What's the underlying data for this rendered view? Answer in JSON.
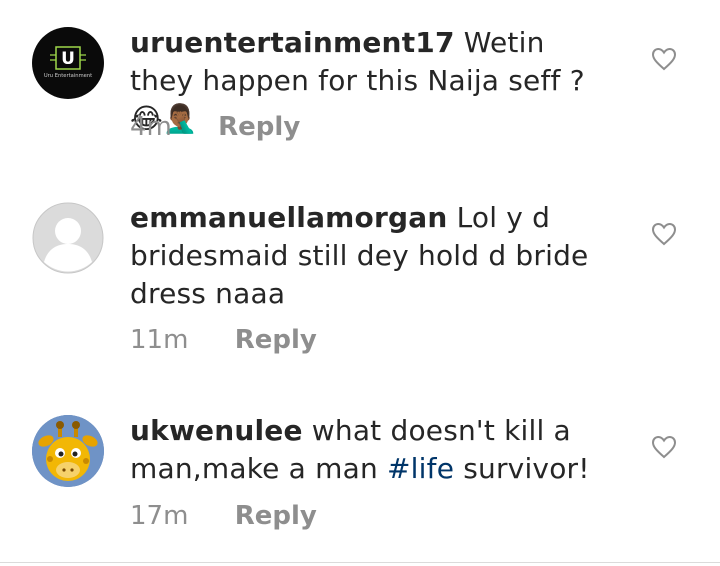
{
  "comments": [
    {
      "username": "uruentertainment17",
      "text": "Wetin they happen for this Naija seff ?",
      "emojis": "😂🤦🏾‍♂️",
      "time": "4m",
      "reply_label": "Reply",
      "avatar": {
        "letter": "U",
        "caption": "Uru Entertainment",
        "bg": "#0a0a0a",
        "accent": "#9ed84a"
      }
    },
    {
      "username": "emmanuellamorgan",
      "text": "Lol y d bridesmaid still dey hold d bride dress naaa",
      "time": "11m",
      "reply_label": "Reply",
      "avatar": {
        "type": "default-profile",
        "bg": "#dbdbdb"
      }
    },
    {
      "username": "ukwenulee",
      "text_before": "what doesn't kill a man,make a man",
      "hashtag": "#life",
      "text_after": "survivor!",
      "time": "17m",
      "reply_label": "Reply",
      "avatar": {
        "type": "cartoon-giraffe"
      }
    }
  ],
  "colors": {
    "text": "#262626",
    "meta": "#8e8e8e",
    "hashtag": "#003569"
  }
}
